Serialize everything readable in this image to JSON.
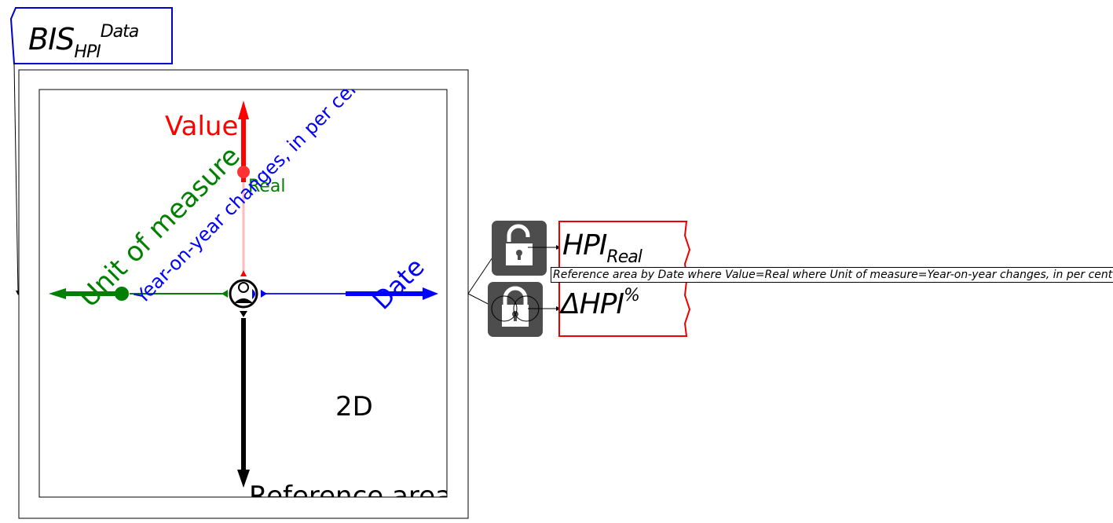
{
  "dataset": {
    "base": "BIS",
    "subscript": "HPI",
    "superscript": "Data"
  },
  "cube": {
    "axes": {
      "value": {
        "label": "Value",
        "member": "Real",
        "color": "#ff0000"
      },
      "unit_of_measure": {
        "label": "Unit of measure",
        "member": "Year-on-year changes, in per cent",
        "color": "#008000"
      },
      "date": {
        "label": "Date",
        "color": "#0000ff"
      },
      "reference_area": {
        "label": "Reference area",
        "color": "#000000"
      }
    },
    "dimension_label": "2D"
  },
  "nodes": {
    "hpi_real": {
      "base": "HPI",
      "subscript": "Real",
      "lock": "unlocked-icon"
    },
    "delta_hpi": {
      "base": "ΔHPI",
      "superscript": "%",
      "lock": "locked-icon"
    }
  },
  "tooltip": "Reference area by Date where Value=Real where Unit of measure=Year-on-year changes, in per cent"
}
